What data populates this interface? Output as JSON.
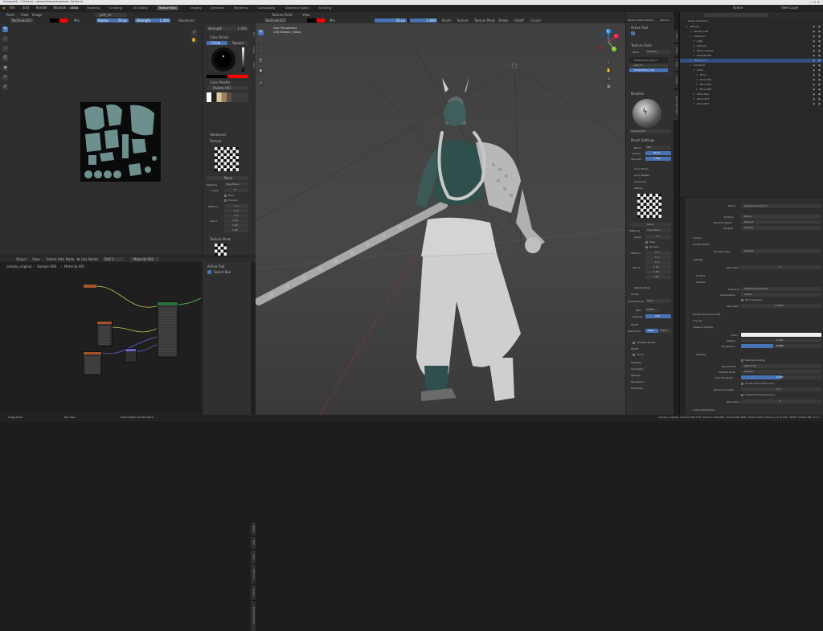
{
  "window": {
    "title": "[Unsaved] - C:\\Users\\...\\project\\sample\\sample_3d.blend"
  },
  "menu": [
    "File",
    "Edit",
    "Render",
    "Window",
    "Help"
  ],
  "workspaces": [
    "Layout",
    "Modeling",
    "Sculpting",
    "UV Editing",
    "Texture Paint",
    "Shading",
    "Animation",
    "Rendering",
    "Compositing",
    "Geometry Nodes",
    "Scripting"
  ],
  "active_workspace": "Texture Paint",
  "scene": {
    "name": "Scene",
    "view_layer": "View Layer"
  },
  "image_editor": {
    "header": {
      "mode": "Paint",
      "view": "View",
      "image": "Image",
      "image_name": "pelt_inl",
      "brush": "TexDraw.001",
      "blend": "Mix",
      "radius_label": "Radius",
      "radius": "50 px",
      "strength_label": "Strength",
      "strength": "1.000",
      "advanced": "Advanced"
    },
    "tool_header": {
      "strength_label": "Strength",
      "strength_value": "1.000"
    },
    "props": {
      "color_picker": "Color Picker",
      "color_tabs": [
        "Circle",
        "Square"
      ],
      "color_palette": "Color Palette",
      "palette_name": "Palette.001",
      "advanced": "Advanced",
      "texture": "Texture",
      "none": "None",
      "mapping_label": "Mapping",
      "mapping": "View Plane",
      "angle_label": "Angle",
      "angle": "0°",
      "rake": "Rake",
      "random": "Random",
      "offset_label": "Offset X",
      "offsets": [
        "0 m",
        "0 m",
        "0 m"
      ],
      "size_label": "Size X",
      "sizes": [
        "1.00",
        "1.00",
        "1.00"
      ],
      "texture_mask": "Texture Mask"
    },
    "side_tabs": [
      "Tool",
      "Image",
      "View"
    ]
  },
  "node_editor": {
    "header": {
      "object": "Object",
      "view": "View",
      "select": "Select",
      "add": "Add",
      "node": "Node",
      "use_nodes": "Use Nodes",
      "slot": "Slot 1",
      "material": "Material.001"
    },
    "breadcrumb": [
      "sample_original",
      "Sample.008",
      "Material.001"
    ],
    "panel": {
      "title": "Active Tool",
      "item": "Select Box"
    },
    "side_tabs": [
      "Node",
      "Tool",
      "View",
      "Options",
      "Group",
      "Node Wrangler"
    ]
  },
  "viewport": {
    "header": {
      "mode": "Texture Paint",
      "view": "View",
      "brush": "TexDraw.001",
      "blend": "Mix",
      "radius": "50 px",
      "strength": "1.000",
      "brush_menu": "Brush",
      "texture_menu": "Texture",
      "texture_mask_menu": "Texture Mask",
      "stroke": "Stroke",
      "falloff": "Falloff",
      "cursor": "Cursor"
    },
    "overlay_text": {
      "line1": "User Perspective",
      "line2": "(18) Sample | Kibou"
    },
    "gizmo": {
      "x": "X",
      "y": "Y",
      "z": "Z"
    },
    "side_tabs": [
      "Tool",
      "View",
      "Edit",
      "Create",
      "Node Wrangler"
    ]
  },
  "tool_panel": {
    "header_tabs": [
      "Texture Slots",
      "Masking",
      "Options"
    ],
    "active_tool": "Active Tool",
    "texture_slots": "Texture Slots",
    "mode_label": "Mode",
    "mode": "Material",
    "slots": [
      "Untextured_map_tr",
      "pelt_inl",
      "Subsurface_map"
    ],
    "brushes": "Brushes",
    "brush_name": "TexDraw.001",
    "brush_settings": "Brush Settings",
    "blend_label": "Blend",
    "blend": "Mix",
    "radius_label": "Radius",
    "radius": "50 px",
    "strength_label": "Strength",
    "strength": "1.000",
    "color_picker": "Color Picker",
    "color_palette": "Color Palette",
    "advanced": "Advanced",
    "texture": "Texture",
    "none": "None",
    "mapping_label": "Mapping",
    "mapping": "View Plane",
    "angle_label": "Angle",
    "angle": "0°",
    "rake": "Rake",
    "random": "Random",
    "offset_label": "Offset X",
    "offsets": [
      "0 m",
      "0 m",
      "0 m"
    ],
    "size_label": "Size X",
    "sizes": [
      "1.00",
      "1.00",
      "1.00"
    ],
    "texture_mask": "Texture Mask",
    "stroke": "Stroke",
    "stroke_method_label": "Stroke Method",
    "stroke_method": "Dots",
    "jitter_label": "Jitter",
    "jitter": "0.0000",
    "spacing_label": "Spacing",
    "spacing": "10%",
    "falloff": "Falloff",
    "radius_unit": "Radius Unit",
    "view": "View",
    "scene": "Scene",
    "cursor": "Cursor",
    "smooth_stroke": "Stabilize Stroke",
    "falloff_sub": "Falloff",
    "curve": "Curve",
    "masking": "Masking",
    "symmetry": "Symmetry",
    "options": "Options",
    "workspace": "Workspace",
    "multi_layer": "MultiLayer"
  },
  "outliner": {
    "title": "Scene Collection",
    "items": [
      "Blender",
      "sample_text",
      "Collection",
      "Light",
      "Camera",
      "Mesh_sample",
      "Sample.008",
      "sample_ref",
      "Armature",
      "Kibou",
      "Bone",
      "Bone.001",
      "Bone.002",
      "Bone.003",
      "Kibou.001",
      "Kibou.002",
      "Kibou.003"
    ]
  },
  "material_props": {
    "name_label": "Name",
    "name_value": "Untextured_map_tr",
    "surface_label": "Surface",
    "surface_value": "Bump",
    "distance_label": "Distance Bump",
    "distance_value": "Default",
    "tangent_label": "Tangent",
    "tangent_value": "Default",
    "volume": "Volume",
    "displacement": "Displacement",
    "disp_label": "Displacement",
    "disp_value": "Default",
    "settings": "Settings",
    "pass_index_label": "Pass Index",
    "pass_index": "0",
    "surface": "Surface",
    "volume2": "Volume",
    "sampling_label": "Sampling",
    "sampling": "Multiple Importance",
    "interpolation_label": "Interpolation",
    "interpolation": "Linear",
    "homogeneous": "Homogeneous",
    "step_rate_label": "Step Rate",
    "step_rate": "1.0000",
    "render_lines": "Render Lines (Line Art)",
    "line_art": "Line Art",
    "viewport_display": "Viewport Display",
    "color_label": "Color",
    "metallic_label": "Metallic",
    "metallic": "0.000",
    "roughness_label": "Roughness",
    "roughness": "0.400",
    "settings2": "Settings",
    "backface_label": "Backface Culling",
    "blend_mode_label": "Blend Mode",
    "blend_mode": "Alpha Clip",
    "shadow_mode_label": "Shadow Mode",
    "shadow_mode": "Opaque",
    "clip_label": "Clip Threshold",
    "clip": "0.500",
    "screen_space": "Screen Space Refraction",
    "refraction_label": "Refraction Depth",
    "refraction": "0 m",
    "subsurface": "Subsurface Translucency",
    "pass_index2_label": "Pass Index",
    "pass_index2": "0",
    "custom": "Custom Properties"
  },
  "status_bar": {
    "left1": "Image Paint",
    "left2": "Pan View",
    "left3": "Texture Paint Context Menu",
    "right": "sample_original | Verts:22,255,070 | Faces:11,040,064 | Tris:22,081,048 | Objects:0/21 | Memory: 2.41 GiB | VRAM: 3.6/8.0 GiB | 3.3.1"
  },
  "colors": {
    "accent": "#4772b3",
    "primary_color": "#ff0000",
    "header": "#2b2b2b",
    "panel": "#2e2e2e",
    "viewport_bg": "#3d3d3d"
  }
}
